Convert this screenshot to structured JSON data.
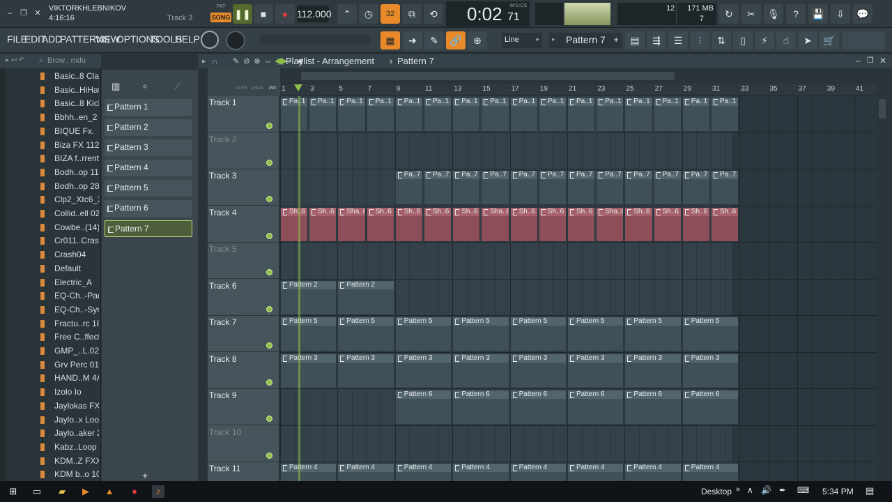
{
  "top": {
    "user": "VIKTORKHLEBNIKOV",
    "time_info": "4:16:16",
    "track_hint": "Track 3",
    "pat_label": "PAT",
    "song_label": "SONG",
    "tempo": "112.000",
    "clock": "0:02",
    "clock_ms": "71",
    "clock_fmt": "M:S:CS",
    "cpu_num": "12",
    "mem": "171 MB",
    "poly": "7"
  },
  "menu": [
    "FILE",
    "EDIT",
    "ADD",
    "PATTERNS",
    "VIEW",
    "OPTIONS",
    "TOOLS",
    "HELP"
  ],
  "toolbar": {
    "snap_mode": "Line",
    "pattern_select": "Pattern 7"
  },
  "browser": {
    "header": "Brow.. mdu",
    "items": [
      "Basic..8 Clap",
      "Basic..HiHat",
      "Basic..8 Kick",
      "Bbhh..en_2",
      "BIQUE Fx.",
      "Biza FX 112",
      "BIZA f..rrent)",
      "Bodh..op 11",
      "Bodh..op 28",
      "Clp2_Xtc6_2",
      "Collid..ell 02",
      "Cowbe..(14)",
      "Cr011..Crash",
      "Crash04",
      "Default",
      "Electric_A",
      "EQ-Ch..-Pad",
      "EQ-Ch..-Syn",
      "Fractu..rc 18",
      "Free C..ffect",
      "GMP_..L.02",
      "Grv Perc 01",
      "HAND..M 4A",
      "Izolo Io",
      "Jaylokas FX",
      "Jaylo..x Loop",
      "Jaylo..aker 2",
      "Kabz..Loop 2",
      "KDM..Z FXX",
      "KDM b..o 10"
    ]
  },
  "playlist": {
    "title": "Playlist - Arrangement",
    "sep": "›",
    "current": "Pattern 7",
    "picker_cols": [
      "NOTE",
      "CHAN",
      "PAT"
    ]
  },
  "patterns": [
    "Pattern 1",
    "Pattern 2",
    "Pattern 3",
    "Pattern 4",
    "Pattern 5",
    "Pattern 6",
    "Pattern 7"
  ],
  "ruler": [
    "1",
    "3",
    "5",
    "7",
    "9",
    "11",
    "13",
    "15",
    "17",
    "19",
    "21",
    "23",
    "25",
    "27",
    "29",
    "31",
    "33",
    "35",
    "37",
    "39",
    "41"
  ],
  "tracks": [
    {
      "name": "Track 1",
      "dim": false
    },
    {
      "name": "Track 2",
      "dim": true
    },
    {
      "name": "Track 3",
      "dim": false
    },
    {
      "name": "Track 4",
      "dim": false
    },
    {
      "name": "Track 5",
      "dim": true
    },
    {
      "name": "Track 6",
      "dim": false
    },
    {
      "name": "Track 7",
      "dim": false
    },
    {
      "name": "Track 8",
      "dim": false
    },
    {
      "name": "Track 9",
      "dim": false
    },
    {
      "name": "Track 10",
      "dim": true
    },
    {
      "name": "Track 11",
      "dim": false
    }
  ],
  "clip_labels": {
    "t1": "Pa..1",
    "t3": "Pa..7",
    "t4": [
      "Sh..6",
      "Sh..6",
      "Sha..6",
      "Sh..6",
      "Sh..6",
      "Sh..6",
      "Sh..6",
      "Sha..6",
      "Sh..6",
      "Sh..6",
      "Sh..6",
      "Sha..6",
      "Sh..6",
      "Sh..6",
      "Sh..6",
      "Sh..6"
    ],
    "t6": "Pattern 2",
    "t7": "Pattern 5",
    "t8": "Pattern 3",
    "t9": "Pattern 6",
    "t11": "Pattern 4"
  },
  "taskbar": {
    "desktop": "Desktop",
    "time": "5:34 PM"
  }
}
